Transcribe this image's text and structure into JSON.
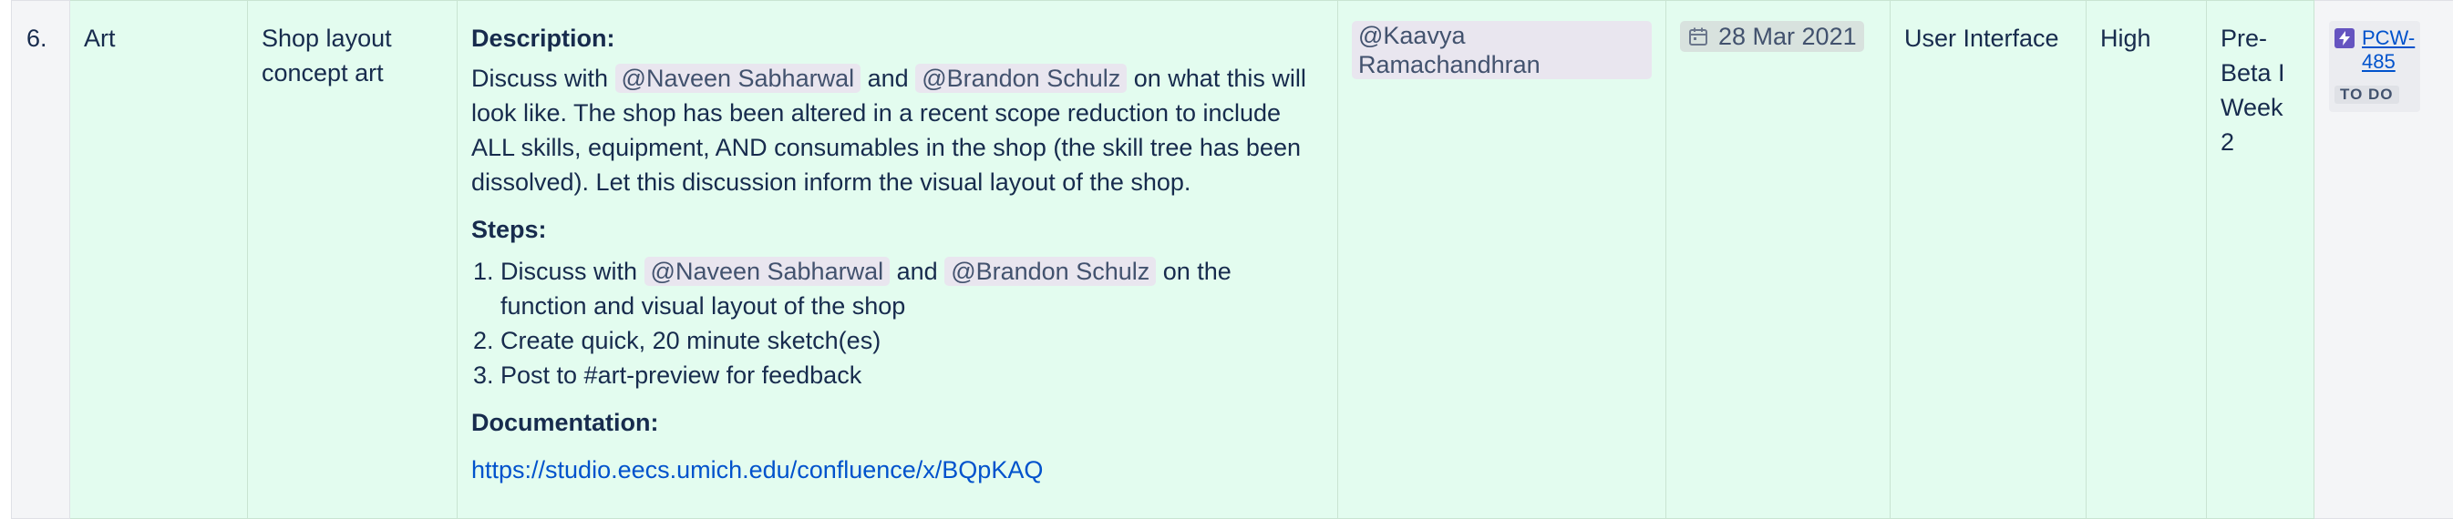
{
  "row": {
    "number": "6.",
    "category": "Art",
    "task": "Shop layout concept art",
    "description_heading": "Description:",
    "description": {
      "prefix": "Discuss with",
      "mention1": "@Naveen Sabharwal",
      "and": "and",
      "mention2": "@Brandon Schulz",
      "rest": "on what this will look like. The shop has been altered in a recent scope reduction to include ALL skills, equipment, AND consumables in the shop (the skill tree has been dissolved). Let this discussion inform the visual layout of the shop."
    },
    "steps_heading": "Steps:",
    "steps": {
      "step1_prefix": "Discuss with",
      "step1_mention1": "@Naveen Sabharwal",
      "step1_and": "and",
      "step1_mention2": "@Brandon Schulz",
      "step1_rest": "on the function and visual layout of the shop",
      "step2": "Create quick, 20 minute sketch(es)",
      "step3": "Post to #art-preview for feedback"
    },
    "documentation_heading": "Documentation:",
    "documentation_link": "https://studio.eecs.umich.edu/confluence/x/BQpKAQ",
    "assignee": "@Kaavya Ramachandhran",
    "due_date": "28 Mar 2021",
    "area": "User Interface",
    "priority": "High",
    "milestone": "Pre-Beta I Week 2",
    "jira": {
      "key": "PCW-485",
      "status": "TO DO"
    }
  },
  "colors": {
    "row_bg": "#e3fcef",
    "grey_cell_bg": "#f4f5f7",
    "link": "#0052cc",
    "jira_icon": "#6554c0"
  }
}
